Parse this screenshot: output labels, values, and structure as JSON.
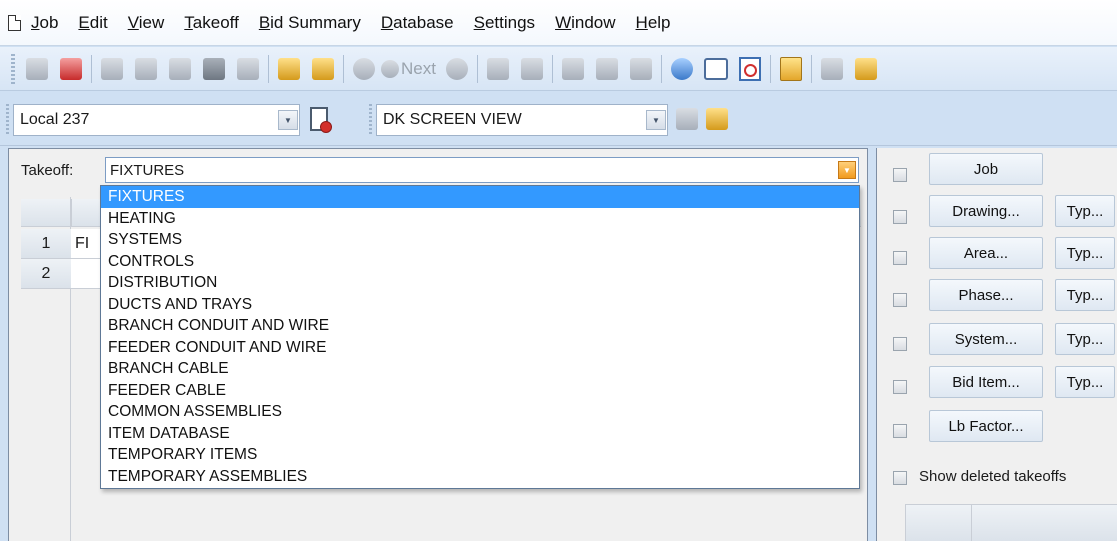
{
  "menu": {
    "items": [
      {
        "label": "Job",
        "underline": "J",
        "rest": "ob"
      },
      {
        "label": "Edit",
        "underline": "E",
        "rest": "dit"
      },
      {
        "label": "View",
        "underline": "V",
        "rest": "iew"
      },
      {
        "label": "Takeoff",
        "underline": "T",
        "rest": "akeoff"
      },
      {
        "label": "Bid Summary",
        "underline": "B",
        "rest": "id Summary"
      },
      {
        "label": "Database",
        "underline": "D",
        "rest": "atabase"
      },
      {
        "label": "Settings",
        "underline": "S",
        "rest": "ettings"
      },
      {
        "label": "Window",
        "underline": "W",
        "rest": "indow"
      },
      {
        "label": "Help",
        "underline": "H",
        "rest": "elp"
      }
    ]
  },
  "toolbar": {
    "next_label": "Next",
    "icons": [
      "save-icon",
      "job-list-icon",
      "cut-icon",
      "copy-icon",
      "paste-icon",
      "delete-icon",
      "edit-icon",
      "previous-record-icon",
      "next-record-icon",
      "stop-icon",
      "next-icon",
      "complete-icon",
      "copy-takeoff-icon",
      "link-icon",
      "move-up-icon",
      "move-down-icon",
      "sort-icon",
      "undo-icon",
      "print-icon",
      "print-preview-icon",
      "calculator-icon",
      "assembly-icon",
      "tools-icon"
    ]
  },
  "selector": {
    "local_value": "Local 237",
    "view_value": "DK SCREEN VIEW"
  },
  "takeoff": {
    "label": "Takeoff:",
    "selected": "FIXTURES",
    "options": [
      "FIXTURES",
      "HEATING",
      "SYSTEMS",
      "CONTROLS",
      "DISTRIBUTION",
      "DUCTS AND TRAYS",
      "BRANCH CONDUIT AND WIRE",
      "FEEDER CONDUIT AND WIRE",
      "BRANCH CABLE",
      "FEEDER CABLE",
      "COMMON ASSEMBLIES",
      "ITEM DATABASE",
      "TEMPORARY ITEMS",
      "TEMPORARY ASSEMBLIES"
    ]
  },
  "grid": {
    "rows": [
      {
        "num": "1",
        "cell": "FI"
      },
      {
        "num": "2",
        "cell": ""
      }
    ]
  },
  "filters": {
    "job": "Job",
    "drawing": "Drawing...",
    "area": "Area...",
    "phase": "Phase...",
    "system": "System...",
    "bid_item": "Bid Item...",
    "lb_factor": "Lb Factor...",
    "type": "Typ...",
    "show_deleted": "Show deleted takeoffs"
  },
  "colors": {
    "selection": "#3399ff",
    "frame": "#cfe0f3"
  }
}
